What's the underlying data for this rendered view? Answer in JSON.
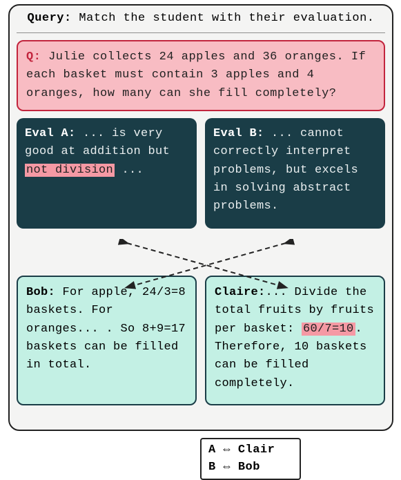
{
  "query": {
    "label": "Query:",
    "text": "Match the student with their evaluation."
  },
  "question": {
    "label": "Q:",
    "text": "Julie collects 24 apples and 36 oranges. If each basket must contain 3 apples and 4 oranges, how many can she fill completely?"
  },
  "evals": {
    "a": {
      "label": "Eval A:",
      "pre": "... is very good at addition but ",
      "highlight": "not division",
      "post": " ..."
    },
    "b": {
      "label": "Eval B:",
      "text": "... cannot correctly interpret problems, but excels in solving abstract problems."
    }
  },
  "students": {
    "bob": {
      "label": "Bob:",
      "text": "For apple, 24/3=8 baskets. For oranges... . So 8+9=17 baskets can be filled in total."
    },
    "claire": {
      "label": "Claire:",
      "pre": "... Divide the total fruits by fruits per basket: ",
      "highlight": "60/7=10",
      "post": ". Therefore, 10 baskets can be filled completely."
    }
  },
  "answer": {
    "rows": [
      {
        "k": "A",
        "arr": "⇔",
        "v": "Clair"
      },
      {
        "k": "B",
        "arr": "⇔",
        "v": "Bob"
      }
    ]
  }
}
